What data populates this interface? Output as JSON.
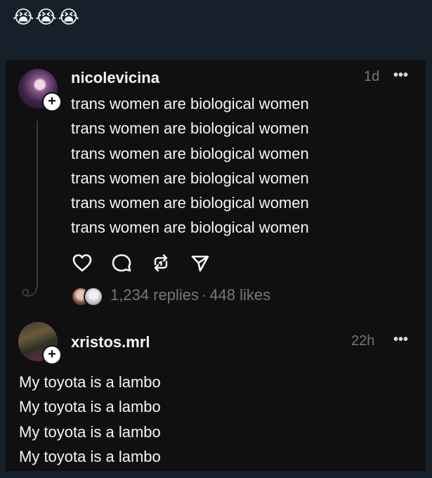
{
  "caption": {
    "emoji": "😭😭😭"
  },
  "post": {
    "username": "nicolevicina",
    "time": "1d",
    "more": "•••",
    "follow_badge": "+",
    "lines": [
      "trans women are biological women",
      "trans women are biological women",
      "trans women are biological women",
      "trans women are biological women",
      "trans women are biological women",
      "trans women are biological women"
    ],
    "actions": [
      "heart-icon",
      "comment-icon",
      "repost-icon",
      "share-icon"
    ],
    "replies": "1,234 replies",
    "separator": "·",
    "likes": "448 likes"
  },
  "reply": {
    "username": "xristos.mrl",
    "time": "22h",
    "more": "•••",
    "follow_badge": "+",
    "lines": [
      "My toyota is a lambo",
      "My toyota is a lambo",
      "My toyota is a lambo",
      "My toyota is a lambo"
    ]
  },
  "colors": {
    "page_background": "#15202b",
    "card_background": "#101010",
    "primary_text": "#f3f5f7",
    "secondary_text": "#777777"
  }
}
